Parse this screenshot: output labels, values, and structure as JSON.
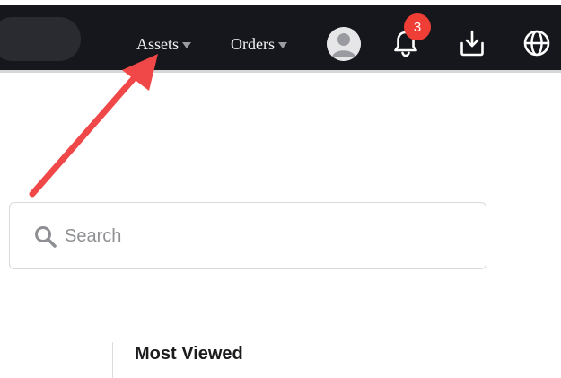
{
  "header": {
    "nav": [
      {
        "label": "Assets"
      },
      {
        "label": "Orders"
      }
    ],
    "notifications": {
      "count": "3"
    },
    "icons": [
      "user-avatar-icon",
      "bell-icon",
      "download-icon",
      "globe-icon"
    ]
  },
  "search": {
    "placeholder": "Search"
  },
  "sections": {
    "most_viewed_title": "Most Viewed"
  },
  "annotation": {
    "arrow_color": "#f04848"
  },
  "colors": {
    "topbar": "#16171c",
    "badge": "#ee3e36"
  }
}
